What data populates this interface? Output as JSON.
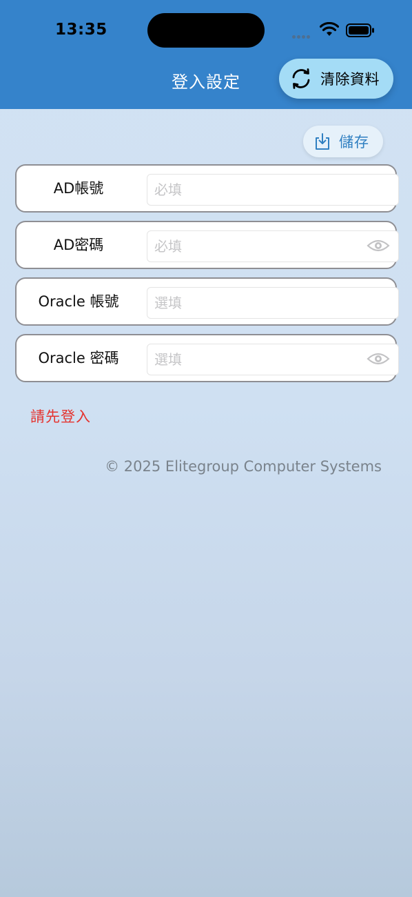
{
  "status_bar": {
    "time": "13:35"
  },
  "header": {
    "title": "登入設定",
    "clear_button_label": "清除資料"
  },
  "toolbar": {
    "save_label": "儲存"
  },
  "form": {
    "rows": [
      {
        "label": "AD帳號",
        "placeholder": "必填",
        "value": ""
      },
      {
        "label": "AD密碼",
        "placeholder": "必填",
        "value": ""
      },
      {
        "label": "Oracle 帳號",
        "placeholder": "選填",
        "value": ""
      },
      {
        "label": "Oracle 密碼",
        "placeholder": "選填",
        "value": ""
      }
    ]
  },
  "status_message": "請先登入",
  "footer": "© 2025 Elitegroup Computer Systems",
  "icons": {
    "clear": "refresh-icon",
    "save": "download-tray-icon",
    "password_toggle": "eye-icon"
  },
  "colors": {
    "header_bg": "#3583cb",
    "clear_button_bg": "#a4dcf6",
    "save_accent": "#2f7fc1",
    "error": "#e5322d"
  }
}
